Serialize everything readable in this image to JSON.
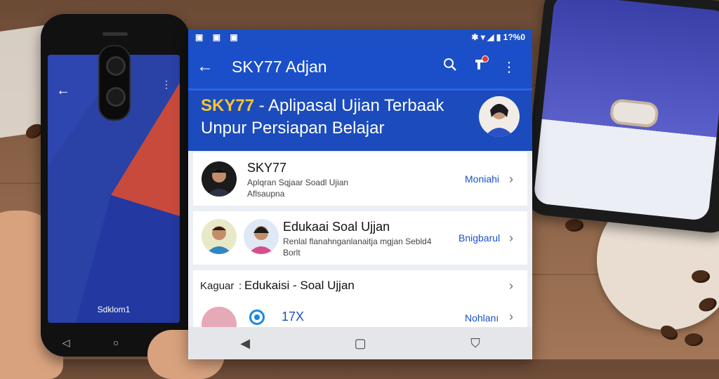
{
  "background": {
    "left_phone": {
      "caption": "Sdklom1"
    }
  },
  "status_bar": {
    "left_icons": [
      "image-icon",
      "image-icon",
      "notification-icon"
    ],
    "right_text": "1?%0"
  },
  "toolbar": {
    "title": "SKY77 Adjan",
    "icons": [
      "back-arrow-icon",
      "search-icon",
      "notification-bell-icon",
      "more-vert-icon"
    ]
  },
  "hero": {
    "brand": "SKY77",
    "line1_rest": " - Aplipasal Ujian Terbaak",
    "line2": "Unpur Persiapan Belajar"
  },
  "cards": [
    {
      "title": "SKY77",
      "subtitle1": "Aplqran Sqjaar Soadl Ujian",
      "subtitle2": "Aflsaupna",
      "action": "Moniahi"
    },
    {
      "title": "Edukaai Soal Ujjan",
      "subtitle1": "Renlal flanahnganlanaitja mgjan Sebld4",
      "subtitle2": "Borlt",
      "action": "Bnigbarul"
    },
    {
      "prefix": "Kaguar",
      "title": "Edukaisi - Soal Ujjan"
    },
    {
      "value": "17X",
      "action": "Nohlanı"
    }
  ],
  "colors": {
    "primary": "#1a4fc9",
    "brand_yellow": "#f6c531",
    "screen_bg": "#ebeef3"
  }
}
